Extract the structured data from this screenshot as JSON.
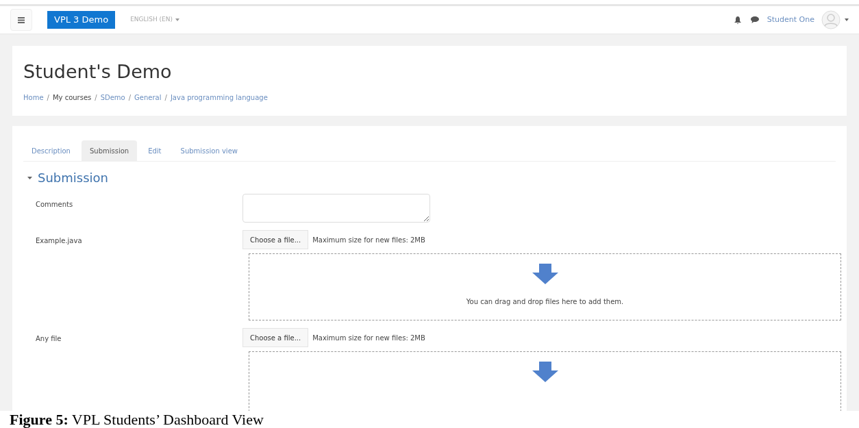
{
  "navbar": {
    "brand": "VPL 3 Demo",
    "language": "ENGLISH (EN)",
    "user": "Student One"
  },
  "page_header": {
    "title": "Student's Demo",
    "breadcrumb": [
      {
        "label": "Home",
        "link": true
      },
      {
        "separator": "/",
        "label": "My courses",
        "link": false
      },
      {
        "separator": "/",
        "label": "SDemo",
        "link": true
      },
      {
        "separator": "/",
        "label": "General",
        "link": true
      },
      {
        "separator": "/",
        "label": "Java programming language",
        "link": true
      }
    ]
  },
  "tabs": [
    {
      "label": "Description",
      "selected": false
    },
    {
      "label": "Submission",
      "selected": true
    },
    {
      "label": "Edit",
      "selected": false
    },
    {
      "label": "Submission view",
      "selected": false
    }
  ],
  "section": {
    "title": "Submission",
    "expanded": true
  },
  "fields": [
    {
      "kind": "textarea",
      "label": "Comments"
    },
    {
      "kind": "file",
      "label": "Example.java",
      "button": "Choose a file...",
      "note": "Maximum size for new files: 2MB",
      "drop_text": "You can drag and drop files here to add them."
    },
    {
      "kind": "file",
      "label": "Any file",
      "button": "Choose a file...",
      "note": "Maximum size for new files: 2MB"
    }
  ],
  "caption": "**Figure 5:** VPL Students’ Dashboard View"
}
